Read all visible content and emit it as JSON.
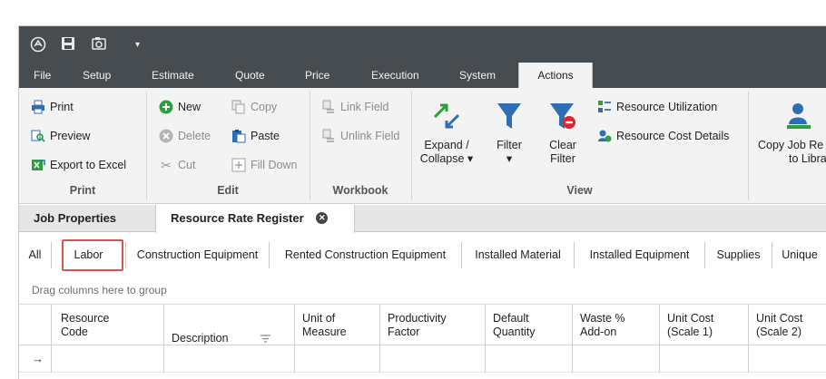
{
  "app": {
    "menu": [
      "File",
      "Setup",
      "Estimate",
      "Quote",
      "Price",
      "Execution",
      "System",
      "Actions"
    ],
    "active_menu": "Actions"
  },
  "ribbon": {
    "print_group": {
      "label": "Print",
      "print": "Print",
      "preview": "Preview",
      "export": "Export to Excel"
    },
    "edit_group": {
      "label": "Edit",
      "new": "New",
      "copy": "Copy",
      "delete": "Delete",
      "paste": "Paste",
      "cut": "Cut",
      "fill_down": "Fill Down"
    },
    "workbook_group": {
      "label": "Workbook",
      "link_field": "Link Field",
      "unlink_field": "Unlink Field"
    },
    "view_group": {
      "label": "View",
      "expand_line1": "Expand /",
      "expand_line2": "Collapse ▾",
      "filter_line1": "Filter",
      "filter_line2": "▾",
      "clear_line1": "Clear",
      "clear_line2": "Filter",
      "resource_utilization": "Resource Utilization",
      "resource_cost_details": "Resource Cost Details"
    },
    "copy_job": {
      "line1": "Copy Job Re",
      "line2": "to Libra"
    }
  },
  "doc_tabs": {
    "job_properties": "Job Properties",
    "resource_rate_register": "Resource Rate Register",
    "close_glyph": "✕"
  },
  "sub_tabs": [
    "All",
    "Labor",
    "Construction Equipment",
    "Rented Construction Equipment",
    "Installed Material",
    "Installed Equipment",
    "Supplies",
    "Unique"
  ],
  "active_sub_tab": "Labor",
  "grid": {
    "group_hint": "Drag columns here to group",
    "columns": [
      "Resource\nCode",
      "Description",
      "Unit of\nMeasure",
      "Productivity\nFactor",
      "Default\nQuantity",
      "Waste %\nAdd-on",
      "Unit Cost\n(Scale 1)",
      "Unit Cost\n(Scale 2)"
    ],
    "row_indicator": "→"
  },
  "colors": {
    "title_bar": "#474c50",
    "ribbon_bg": "#f3f3f3",
    "highlight_box": "#d9534f",
    "accent_blue": "#2f6db5",
    "accent_green": "#2e9e3f",
    "danger_red": "#e0262b"
  }
}
